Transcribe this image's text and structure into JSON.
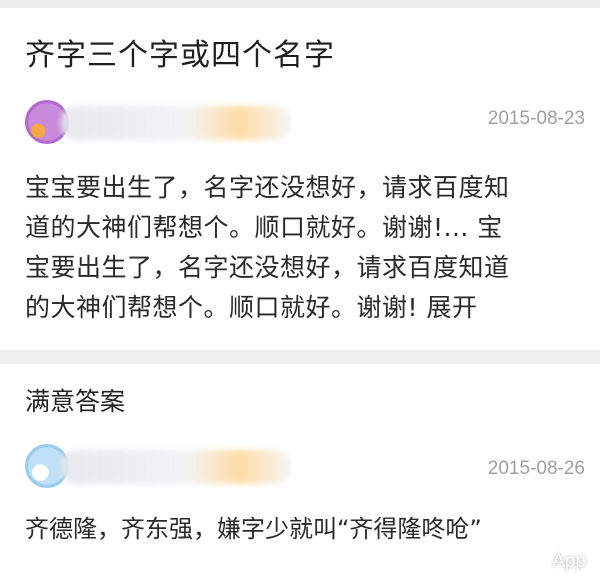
{
  "question": {
    "title": "齐字三个字或四个名字",
    "date": "2015-08-23",
    "body_lines": [
      "宝宝要出生了，名字还没想好，请求百度知",
      "道的大神们帮想个。顺口就好。谢谢!... 宝",
      "宝要出生了，名字还没想好，请求百度知道",
      "的大神们帮想个。顺口就好。谢谢!"
    ],
    "expand_label": "展开"
  },
  "answer": {
    "heading": "满意答案",
    "date": "2015-08-26",
    "body": "齐德隆，齐东强，嫌字少就叫“齐得隆咚呛”"
  },
  "watermark": "App"
}
